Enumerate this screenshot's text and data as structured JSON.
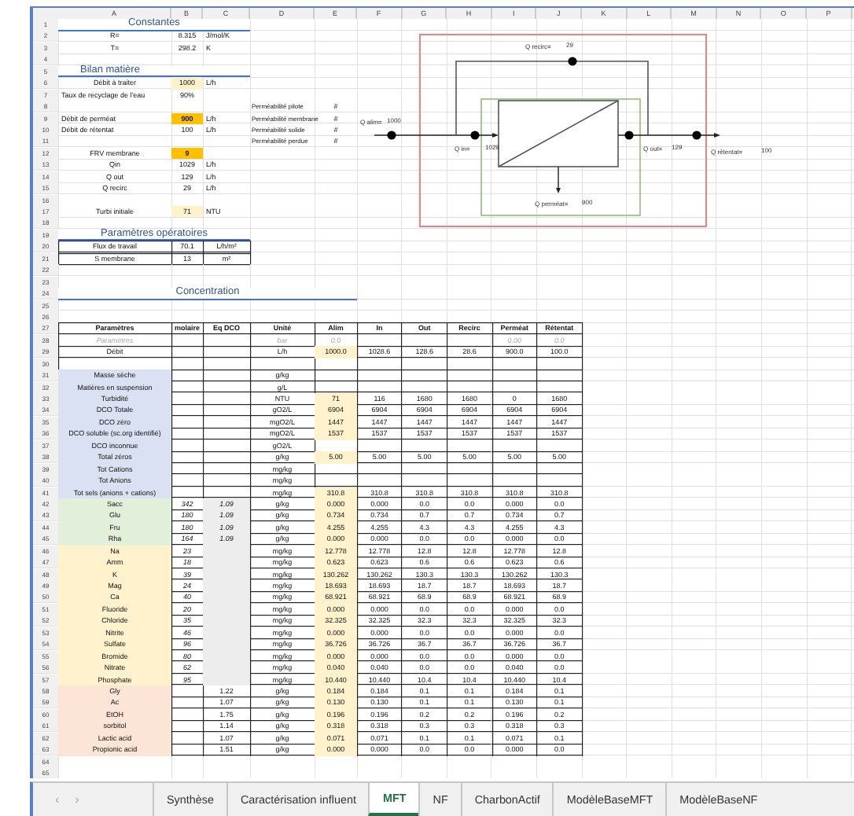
{
  "sheet": {
    "columns": [
      "A",
      "B",
      "C",
      "D",
      "E",
      "F",
      "G",
      "H",
      "I",
      "J",
      "K",
      "L",
      "M",
      "N",
      "O",
      "P"
    ],
    "rows": [
      {
        "number": "1",
        "kind": "title",
        "cells": [
          "Constantes"
        ]
      },
      {
        "number": "2",
        "cells": [
          "R=",
          "8.315",
          "J/mol/K"
        ]
      },
      {
        "number": "3",
        "cells": [
          "T=",
          "298.2",
          "K"
        ]
      },
      {
        "number": "4"
      },
      {
        "number": "5",
        "kind": "title-left",
        "cells": [
          "Bilan matière"
        ]
      },
      {
        "number": "6",
        "cells": [
          "Débit à traiter",
          {
            "text": "1000",
            "kind": "pale"
          },
          "L/h"
        ]
      },
      {
        "number": "7",
        "cells": [
          {
            "text": "Taux de recyclage de l'eau",
            "kind": "left"
          },
          "90%"
        ]
      },
      {
        "number": "8",
        "cells": [
          null,
          null,
          null,
          {
            "text": "Perméabilité pilote",
            "kind": "tiny"
          },
          "#"
        ]
      },
      {
        "number": "9",
        "cells": [
          {
            "text": "Débit de perméat",
            "kind": "left"
          },
          {
            "text": "900",
            "kind": "input"
          },
          "L/h",
          {
            "text": "Perméabilité membrane",
            "kind": "tiny"
          },
          "#"
        ]
      },
      {
        "number": "10",
        "cells": [
          {
            "text": "Débit de rétentat",
            "kind": "left"
          },
          "100",
          "L/h",
          {
            "text": "Perméabilité solide",
            "kind": "tiny"
          },
          "#"
        ]
      },
      {
        "number": "11",
        "cells": [
          null,
          null,
          null,
          {
            "text": "Perméabilité perdue",
            "kind": "tiny"
          },
          "#"
        ]
      },
      {
        "number": "12",
        "cells": [
          "FRV membrane",
          {
            "text": "9",
            "kind": "input"
          }
        ]
      },
      {
        "number": "13",
        "cells": [
          "Qin",
          "1029",
          "L/h"
        ]
      },
      {
        "number": "14",
        "cells": [
          "Q out",
          "129",
          "L/h"
        ]
      },
      {
        "number": "15",
        "cells": [
          "Q recirc",
          "29",
          "L/h"
        ]
      },
      {
        "number": "16"
      },
      {
        "number": "17",
        "cells": [
          "Turbi initiale",
          {
            "text": "71",
            "kind": "pale"
          },
          "NTU"
        ]
      },
      {
        "number": "18"
      },
      {
        "number": "19",
        "kind": "title",
        "cells": [
          "Paramètres opératoires"
        ]
      },
      {
        "number": "20",
        "kind": "box",
        "cells": [
          "Flux de travail",
          "70.1",
          "L/h/m²"
        ]
      },
      {
        "number": "21",
        "kind": "box",
        "cells": [
          "S membrane",
          "13",
          "m²"
        ]
      },
      {
        "number": "22"
      },
      {
        "number": "23"
      },
      {
        "number": "24",
        "kind": "title-wide",
        "cells": [
          "Concentration"
        ]
      },
      {
        "number": "25"
      },
      {
        "number": "26"
      },
      {
        "number": "27",
        "kind": "header",
        "cells": [
          "Paramètres",
          "molaire",
          "Eq DCO",
          "Unité",
          "Alim",
          "In",
          "Out",
          "Recirc",
          "Perméat",
          "Rétentat"
        ]
      },
      {
        "number": "28",
        "kind": "faint",
        "cells": [
          "Paramètres",
          null,
          null,
          "bar",
          "0.0",
          null,
          null,
          null,
          "0.00",
          "0.0"
        ]
      },
      {
        "number": "29",
        "kind": "main",
        "cells": [
          "Débit",
          null,
          null,
          "L/h",
          "1000.0",
          "1028.6",
          "128.6",
          "28.6",
          "900.0",
          "100.0"
        ]
      },
      {
        "number": "30",
        "kind": "main"
      },
      {
        "number": "31",
        "kind": "main",
        "color": "#d9e1f2",
        "cells": [
          "Masse sèche",
          null,
          null,
          "g/kg"
        ]
      },
      {
        "number": "32",
        "kind": "main",
        "color": "#d9e1f2",
        "cells": [
          "Matières en suspension",
          null,
          null,
          "g/L"
        ]
      },
      {
        "number": "33",
        "kind": "main",
        "color": "#d9e1f2",
        "cells": [
          "Turbidité",
          null,
          null,
          "NTU",
          "71",
          "116",
          "1680",
          "1680",
          "0",
          "1680"
        ]
      },
      {
        "number": "34",
        "kind": "main",
        "color": "#d9e1f2",
        "cells": [
          "DCO Totale",
          null,
          null,
          "gO2/L",
          "6904",
          "6904",
          "6904",
          "6904",
          "6904",
          "6904"
        ]
      },
      {
        "number": "35",
        "kind": "main",
        "color": "#d9e1f2",
        "cells": [
          "DCO zéro",
          null,
          null,
          "mgO2/L",
          "1447",
          "1447",
          "1447",
          "1447",
          "1447",
          "1447"
        ]
      },
      {
        "number": "36",
        "kind": "main",
        "color": "#d9e1f2",
        "cells": [
          "DCO soluble (sc.org identifié)",
          null,
          null,
          "mgO2/L",
          "1537",
          "1537",
          "1537",
          "1537",
          "1537",
          "1537"
        ]
      },
      {
        "number": "37",
        "kind": "main",
        "color": "#d9e1f2",
        "cells": [
          "DCO inconnue",
          null,
          null,
          "gO2/L"
        ]
      },
      {
        "number": "38",
        "kind": "main",
        "color": "#d9e1f2",
        "cells": [
          "Total zéros",
          null,
          null,
          "g/kg",
          "5.00",
          "5.00",
          "5.00",
          "5.00",
          "5.00",
          "5.00"
        ]
      },
      {
        "number": "39",
        "kind": "main",
        "color": "#d9e1f2",
        "cells": [
          "Tot Cations",
          null,
          null,
          "mg/kg"
        ]
      },
      {
        "number": "40",
        "kind": "main",
        "color": "#d9e1f2",
        "cells": [
          "Tot Anions",
          null,
          null,
          "mg/kg"
        ]
      },
      {
        "number": "41",
        "kind": "main",
        "color": "#d9e1f2",
        "cells": [
          "Tot sels (anions + cations)",
          null,
          null,
          "mg/kg",
          "310.8",
          "310.8",
          "310.8",
          "310.8",
          "310.8",
          "310.8"
        ]
      },
      {
        "number": "42",
        "kind": "main",
        "color": "#e2efda",
        "cells": [
          "Sacc",
          {
            "text": "342",
            "kind": "italic"
          },
          {
            "text": "1.09",
            "kind": "shaded"
          },
          "g/kg",
          "0.000",
          "0.000",
          "0.0",
          "0.0",
          "0.000",
          "0.0"
        ]
      },
      {
        "number": "43",
        "kind": "main",
        "color": "#e2efda",
        "cells": [
          "Glu",
          {
            "text": "180",
            "kind": "italic"
          },
          {
            "text": "1.09",
            "kind": "shaded"
          },
          "g/kg",
          "0.734",
          "0.734",
          "0.7",
          "0.7",
          "0.734",
          "0.7"
        ]
      },
      {
        "number": "44",
        "kind": "main",
        "color": "#e2efda",
        "cells": [
          "Fru",
          {
            "text": "180",
            "kind": "italic"
          },
          {
            "text": "1.09",
            "kind": "shaded"
          },
          "g/kg",
          "4.255",
          "4.255",
          "4.3",
          "4.3",
          "4.255",
          "4.3"
        ]
      },
      {
        "number": "45",
        "kind": "main",
        "color": "#e2efda",
        "cells": [
          "Rha",
          {
            "text": "164",
            "kind": "italic"
          },
          {
            "text": "1.09",
            "kind": "shaded"
          },
          "g/kg",
          "0.000",
          "0.000",
          "0.0",
          "0.0",
          "0.000",
          "0.0"
        ]
      },
      {
        "number": "46",
        "kind": "main",
        "color": "#fff2cc",
        "cells": [
          "Na",
          {
            "text": "23",
            "kind": "italic"
          },
          {
            "kind": "shaded"
          },
          "mg/kg",
          "12.778",
          "12.778",
          "12.8",
          "12.8",
          "12.778",
          "12.8"
        ]
      },
      {
        "number": "47",
        "kind": "main",
        "color": "#fff2cc",
        "cells": [
          "Amm",
          {
            "text": "18",
            "kind": "italic"
          },
          {
            "kind": "shaded"
          },
          "mg/kg",
          "0.623",
          "0.623",
          "0.6",
          "0.6",
          "0.623",
          "0.6"
        ]
      },
      {
        "number": "48",
        "kind": "main",
        "color": "#fff2cc",
        "cells": [
          "K",
          {
            "text": "39",
            "kind": "italic"
          },
          {
            "kind": "shaded"
          },
          "mg/kg",
          "130.262",
          "130.262",
          "130.3",
          "130.3",
          "130.262",
          "130.3"
        ]
      },
      {
        "number": "49",
        "kind": "main",
        "color": "#fff2cc",
        "cells": [
          "Mag",
          {
            "text": "24",
            "kind": "italic"
          },
          {
            "kind": "shaded"
          },
          "mg/kg",
          "18.693",
          "18.693",
          "18.7",
          "18.7",
          "18.693",
          "18.7"
        ]
      },
      {
        "number": "50",
        "kind": "main",
        "color": "#fff2cc",
        "cells": [
          "Ca",
          {
            "text": "40",
            "kind": "italic"
          },
          {
            "kind": "shaded"
          },
          "mg/kg",
          "68.921",
          "68.921",
          "68.9",
          "68.9",
          "68.921",
          "68.9"
        ]
      },
      {
        "number": "51",
        "kind": "main",
        "color": "#fff2cc",
        "cells": [
          "Fluoride",
          {
            "text": "20",
            "kind": "italic"
          },
          {
            "kind": "shaded"
          },
          "mg/kg",
          "0.000",
          "0.000",
          "0.0",
          "0.0",
          "0.000",
          "0.0"
        ]
      },
      {
        "number": "52",
        "kind": "main",
        "color": "#fff2cc",
        "cells": [
          "Chloride",
          {
            "text": "35",
            "kind": "italic"
          },
          {
            "kind": "shaded"
          },
          "mg/kg",
          "32.325",
          "32.325",
          "32.3",
          "32.3",
          "32.325",
          "32.3"
        ]
      },
      {
        "number": "53",
        "kind": "main",
        "color": "#fff2cc",
        "cells": [
          "Nitrite",
          {
            "text": "46",
            "kind": "italic"
          },
          {
            "kind": "shaded"
          },
          "mg/kg",
          "0.000",
          "0.000",
          "0.0",
          "0.0",
          "0.000",
          "0.0"
        ]
      },
      {
        "number": "54",
        "kind": "main",
        "color": "#fff2cc",
        "cells": [
          "Sulfate",
          {
            "text": "96",
            "kind": "italic"
          },
          {
            "kind": "shaded"
          },
          "mg/kg",
          "36.726",
          "36.726",
          "36.7",
          "36.7",
          "36.726",
          "36.7"
        ]
      },
      {
        "number": "55",
        "kind": "main",
        "color": "#fff2cc",
        "cells": [
          "Bromide",
          {
            "text": "80",
            "kind": "italic"
          },
          {
            "kind": "shaded"
          },
          "mg/kg",
          "0.000",
          "0.000",
          "0.0",
          "0.0",
          "0.000",
          "0.0"
        ]
      },
      {
        "number": "56",
        "kind": "main",
        "color": "#fff2cc",
        "cells": [
          "Nitrate",
          {
            "text": "62",
            "kind": "italic"
          },
          {
            "kind": "shaded"
          },
          "mg/kg",
          "0.040",
          "0.040",
          "0.0",
          "0.0",
          "0.040",
          "0.0"
        ]
      },
      {
        "number": "57",
        "kind": "main",
        "color": "#fff2cc",
        "cells": [
          "Phosphate",
          {
            "text": "95",
            "kind": "italic"
          },
          {
            "kind": "shaded"
          },
          "mg/kg",
          "10.440",
          "10.440",
          "10.4",
          "10.4",
          "10.440",
          "10.4"
        ]
      },
      {
        "number": "58",
        "kind": "main",
        "color": "#fce4d6",
        "cells": [
          "Gly",
          null,
          "1.22",
          "g/kg",
          "0.184",
          "0.184",
          "0.1",
          "0.1",
          "0.184",
          "0.1"
        ]
      },
      {
        "number": "59",
        "kind": "main",
        "color": "#fce4d6",
        "cells": [
          "Ac",
          null,
          "1.07",
          "g/kg",
          "0.130",
          "0.130",
          "0.1",
          "0.1",
          "0.130",
          "0.1"
        ]
      },
      {
        "number": "60",
        "kind": "main",
        "color": "#fce4d6",
        "cells": [
          "EtOH",
          null,
          "1.75",
          "g/kg",
          "0.196",
          "0.196",
          "0.2",
          "0.2",
          "0.196",
          "0.2"
        ]
      },
      {
        "number": "61",
        "kind": "main",
        "color": "#fce4d6",
        "cells": [
          "sorbitol",
          null,
          "1.14",
          "g/kg",
          "0.318",
          "0.318",
          "0.3",
          "0.3",
          "0.318",
          "0.3"
        ]
      },
      {
        "number": "62",
        "kind": "main",
        "color": "#fce4d6",
        "cells": [
          "Lactic acid",
          null,
          "1.07",
          "g/kg",
          "0.071",
          "0.071",
          "0.1",
          "0.1",
          "0.071",
          "0.1"
        ]
      },
      {
        "number": "63",
        "kind": "main",
        "color": "#fce4d6",
        "cells": [
          "Propionic acid",
          null,
          "1.51",
          "g/kg",
          "0.000",
          "0.000",
          "0.0",
          "0.0",
          "0.000",
          "0.0"
        ]
      },
      {
        "number": "64"
      },
      {
        "number": "65"
      }
    ]
  },
  "diagram": {
    "flows": [
      {
        "label": "Q alim=",
        "value": "1000"
      },
      {
        "label": "Q recirc=",
        "value": "29"
      },
      {
        "label": "Q in=",
        "value": "1029"
      },
      {
        "label": "Q out=",
        "value": "129"
      },
      {
        "label": "Q rétentat=",
        "value": "100"
      },
      {
        "label": "Q perméat=",
        "value": "900"
      }
    ]
  },
  "sheet_nav": [
    "‹",
    "›"
  ],
  "tabs": [
    {
      "label": "Synthèse",
      "selected": false
    },
    {
      "label": "Caractérisation influent",
      "selected": false
    },
    {
      "label": "MFT",
      "selected": true
    },
    {
      "label": "NF",
      "selected": false
    },
    {
      "label": "CharbonActif",
      "selected": false
    },
    {
      "label": "ModèleBaseMFT",
      "selected": false
    },
    {
      "label": "ModèleBaseNF",
      "selected": false
    }
  ]
}
